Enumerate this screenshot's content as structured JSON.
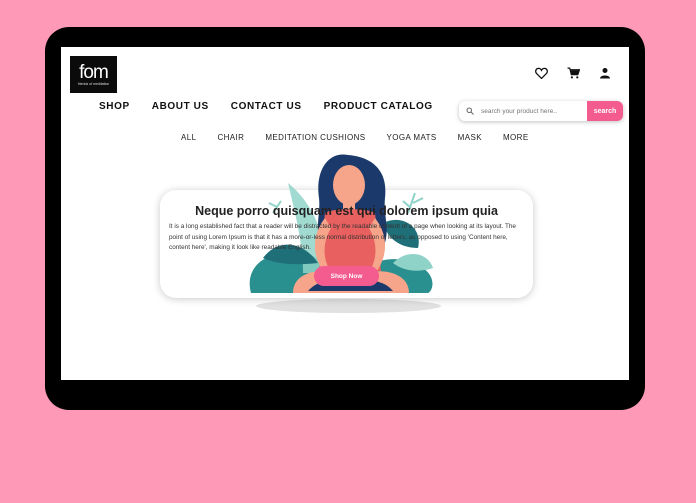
{
  "brand": {
    "logo_mark": "fom",
    "logo_tagline": "friends of meditation"
  },
  "header": {
    "icons": [
      "heart-icon",
      "cart-icon",
      "user-icon"
    ]
  },
  "main_nav": [
    "SHOP",
    "ABOUT US",
    "CONTACT US",
    "PRODUCT CATALOG"
  ],
  "search": {
    "placeholder": "search your product here..",
    "button_label": "search",
    "icon": "search-icon"
  },
  "category_nav": [
    "ALL",
    "CHAIR",
    "MEDITATION CUSHIONS",
    "YOGA MATS",
    "MASK",
    "MORE"
  ],
  "hero": {
    "title": "Neque porro quisquam est qui dolorem ipsum quia",
    "text": "It is a long established fact that a reader will be distracted by the readable content of a page when looking at its layout. The point of using Lorem Ipsum is that it has a more-or-less normal distribution of letters, as opposed to using 'Content here, content here', making it look like readable English.",
    "button_label": "Shop Now"
  },
  "colors": {
    "background": "#fe9ab8",
    "accent": "#f45b8f",
    "device": "#000000",
    "leaf_teal": "#2a8f8f",
    "leaf_light": "#8fd3c8",
    "hair": "#1b3a6b",
    "skin": "#f7a58a"
  }
}
